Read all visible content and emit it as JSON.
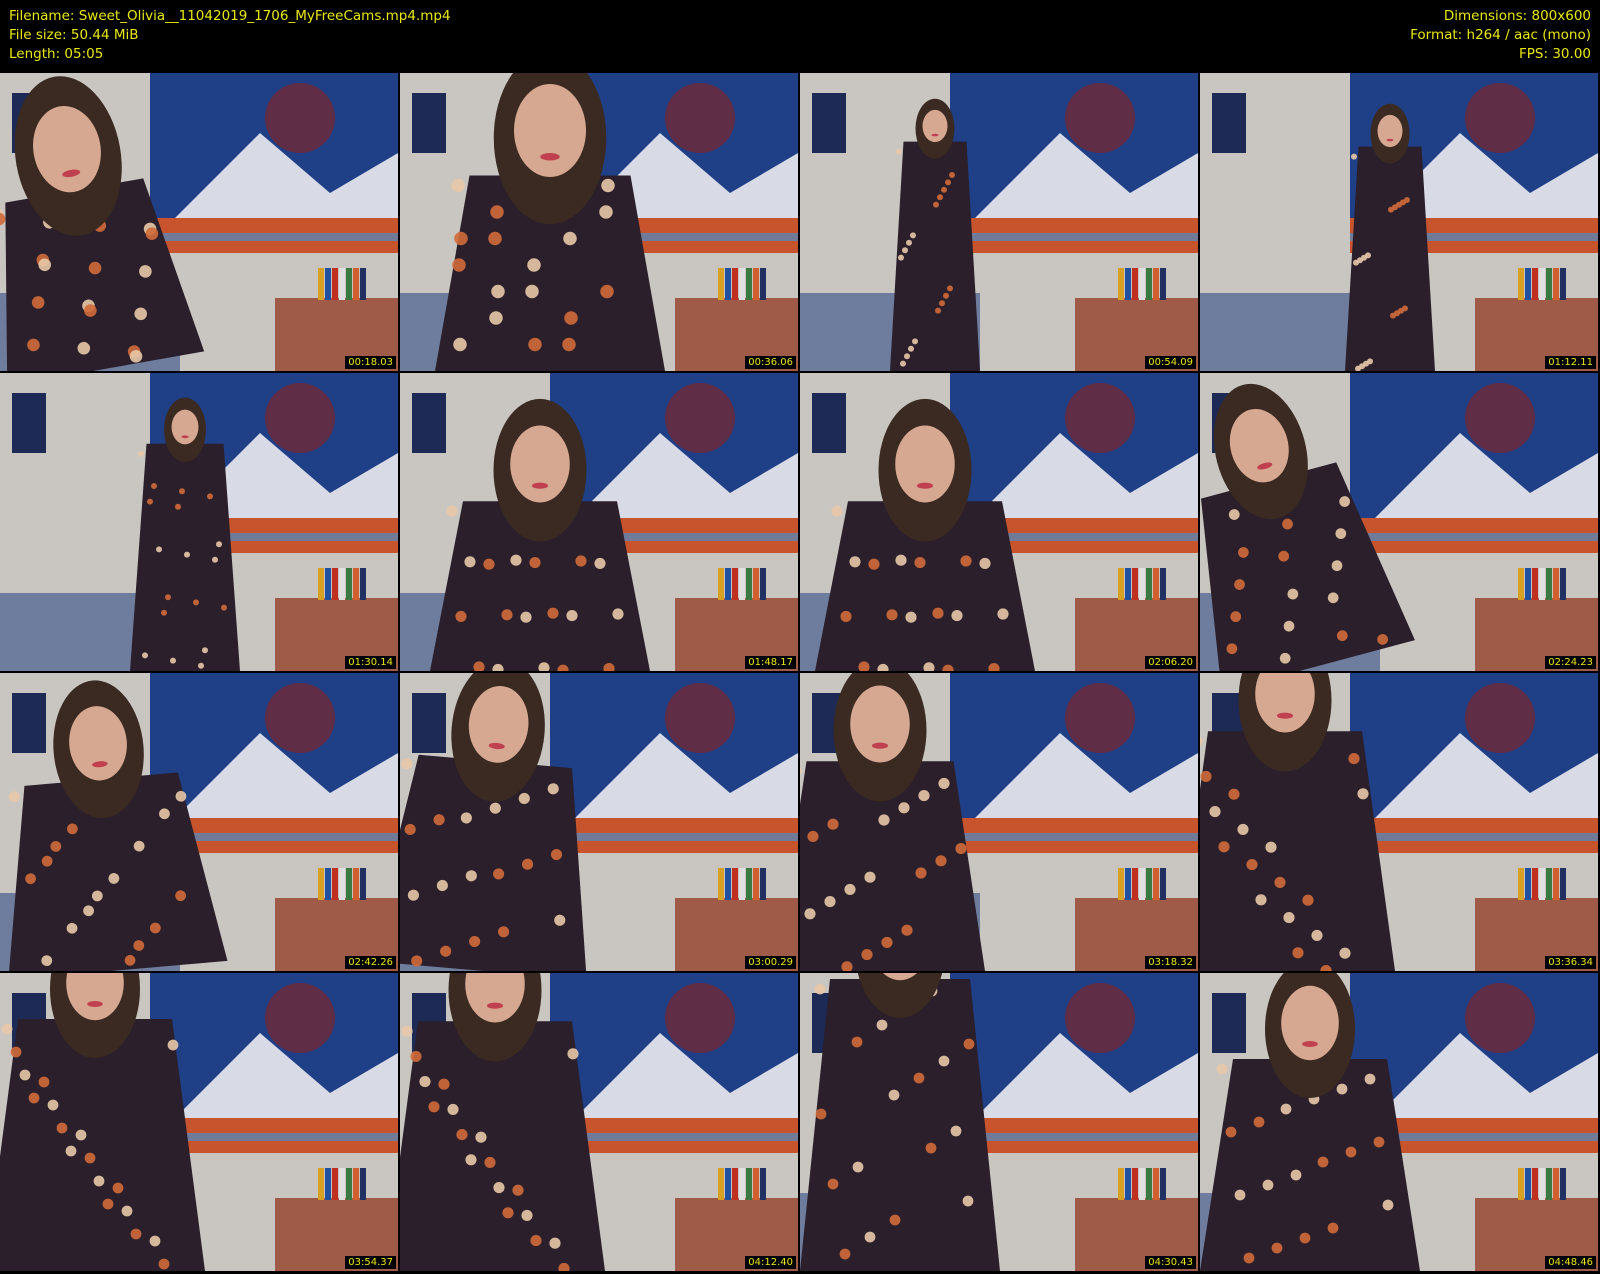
{
  "header": {
    "left": [
      "Filename: Sweet_Olivia__11042019_1706_MyFreeCams.mp4.mp4",
      "File size: 50.44 MiB",
      "Length: 05:05"
    ],
    "right": [
      "Dimensions: 800x600",
      "Format: h264 / aac (mono)",
      "FPS: 30.00"
    ]
  },
  "colors": {
    "background": "#000000",
    "text": "#e8e80a",
    "wall": "#c9c6c2",
    "tapestry_sky": "#1f3f86",
    "tapestry_mountain": "#d8dbe6",
    "tapestry_land": "#c8542e",
    "dresser": "#a05a48",
    "bed": "#6e7d9e",
    "dress": "#2a1f2a",
    "dress_floral": "#d06a3a",
    "hair": "#3a2a22",
    "skin": "#d7a891"
  },
  "frames": [
    {
      "timestamp": "00:18.03"
    },
    {
      "timestamp": "00:36.06"
    },
    {
      "timestamp": "00:54.09"
    },
    {
      "timestamp": "01:12.11"
    },
    {
      "timestamp": "01:30.14"
    },
    {
      "timestamp": "01:48.17"
    },
    {
      "timestamp": "02:06.20"
    },
    {
      "timestamp": "02:24.23"
    },
    {
      "timestamp": "02:42.26"
    },
    {
      "timestamp": "03:00.29"
    },
    {
      "timestamp": "03:18.32"
    },
    {
      "timestamp": "03:36.34"
    },
    {
      "timestamp": "03:54.37"
    },
    {
      "timestamp": "04:12.40"
    },
    {
      "timestamp": "04:30.43"
    },
    {
      "timestamp": "04:48.46"
    }
  ]
}
